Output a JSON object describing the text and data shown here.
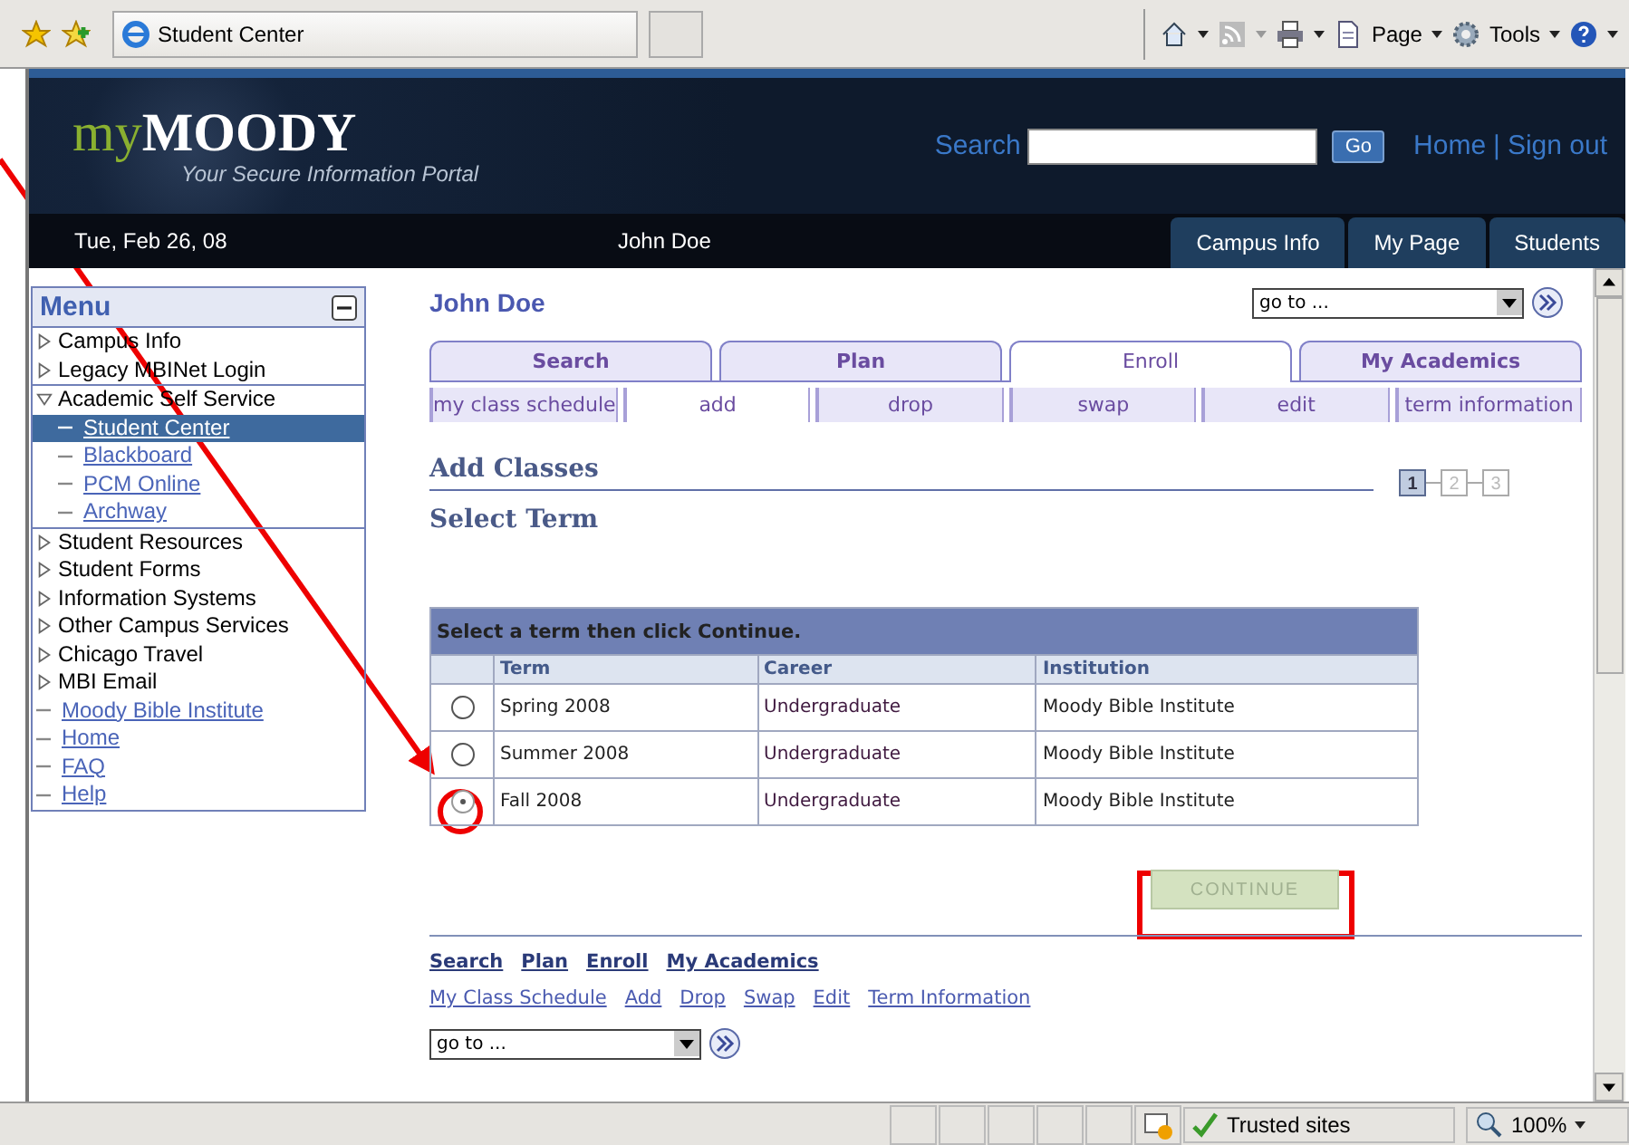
{
  "browser": {
    "tab_title": "Student Center",
    "menus": [
      "Page",
      "Tools"
    ]
  },
  "header": {
    "logo_prefix": "my",
    "logo_main": "MOODY",
    "tagline": "Your Secure Information Portal",
    "search_label": "Search",
    "go_button": "Go",
    "links": [
      "Home",
      "Sign out"
    ],
    "separator": "|"
  },
  "nav": {
    "date": "Tue, Feb 26, 08",
    "user": "John Doe",
    "tabs": [
      "Campus Info",
      "My Page",
      "Students"
    ]
  },
  "menu": {
    "title": "Menu",
    "items": [
      {
        "label": "Campus Info",
        "kind": "folder",
        "expanded": false,
        "selected": false
      },
      {
        "label": "Legacy MBINet Login",
        "kind": "folder",
        "expanded": false,
        "selected": false
      },
      {
        "label": "Academic Self Service",
        "kind": "folder",
        "expanded": true,
        "selected": false,
        "children": [
          {
            "label": "Student Center",
            "kind": "link",
            "selected": true
          },
          {
            "label": "Blackboard",
            "kind": "link",
            "selected": false
          },
          {
            "label": "PCM Online",
            "kind": "link",
            "selected": false
          },
          {
            "label": "Archway",
            "kind": "link",
            "selected": false
          }
        ]
      },
      {
        "label": "Student Resources",
        "kind": "folder",
        "expanded": false,
        "selected": false
      },
      {
        "label": "Student Forms",
        "kind": "folder",
        "expanded": false,
        "selected": false
      },
      {
        "label": "Information Systems",
        "kind": "folder",
        "expanded": false,
        "selected": false
      },
      {
        "label": "Other Campus Services",
        "kind": "folder",
        "expanded": false,
        "selected": false
      },
      {
        "label": "Chicago Travel",
        "kind": "folder",
        "expanded": false,
        "selected": false
      },
      {
        "label": "MBI Email",
        "kind": "folder",
        "expanded": false,
        "selected": false
      },
      {
        "label": "Moody Bible Institute",
        "kind": "link",
        "selected": false
      },
      {
        "label": "Home",
        "kind": "link",
        "selected": false
      },
      {
        "label": "FAQ",
        "kind": "link",
        "selected": false
      },
      {
        "label": "Help",
        "kind": "link",
        "selected": false
      }
    ]
  },
  "main": {
    "user_name": "John Doe",
    "goto": "go to ...",
    "tabs": [
      {
        "label": "Search",
        "selected": false
      },
      {
        "label": "Plan",
        "selected": false
      },
      {
        "label": "Enroll",
        "selected": true
      },
      {
        "label": "My Academics",
        "selected": false
      }
    ],
    "subtabs": [
      {
        "label": "my class schedule",
        "selected": false
      },
      {
        "label": "add",
        "selected": true
      },
      {
        "label": "drop",
        "selected": false
      },
      {
        "label": "swap",
        "selected": false
      },
      {
        "label": "edit",
        "selected": false
      },
      {
        "label": "term information",
        "selected": false
      }
    ],
    "title": "Add Classes",
    "steps": [
      {
        "label": "1",
        "selected": true
      },
      {
        "label": "2",
        "selected": false
      },
      {
        "label": "3",
        "selected": false
      }
    ],
    "subtitle": "Select Term",
    "table": {
      "caption": "Select a term then click Continue.",
      "columns": [
        "Term",
        "Career",
        "Institution"
      ],
      "rows": [
        {
          "selected": false,
          "term": "Spring 2008",
          "career": "Undergraduate",
          "institution": "Moody Bible Institute"
        },
        {
          "selected": false,
          "term": "Summer 2008",
          "career": "Undergraduate",
          "institution": "Moody Bible Institute"
        },
        {
          "selected": true,
          "term": "Fall 2008",
          "career": "Undergraduate",
          "institution": "Moody Bible Institute"
        }
      ]
    },
    "continue_button": "CONTINUE",
    "footer_links": [
      "Search",
      "Plan",
      "Enroll",
      "My Academics"
    ],
    "footer_sublinks": [
      "My Class Schedule",
      "Add",
      "Drop",
      "Swap",
      "Edit",
      "Term Information"
    ],
    "footer_goto": "go to ..."
  },
  "status_bar": {
    "zone": "Trusted sites",
    "zoom": "100%"
  }
}
